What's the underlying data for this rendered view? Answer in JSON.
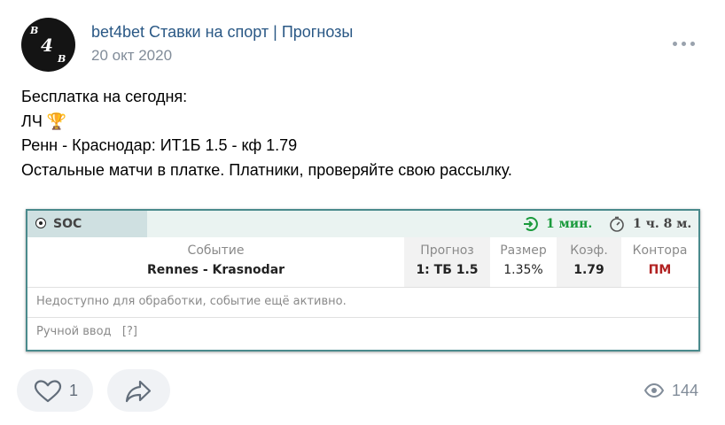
{
  "post": {
    "author": "bet4bet Ставки на спорт | Прогнозы",
    "date": "20 окт 2020",
    "lines": [
      "Бесплатка на сегодня:",
      "ЛЧ 🏆",
      "Ренн - Краснодар: ИТ1Б 1.5 - кф 1.79",
      "Остальные матчи в платке. Платники, проверяйте свою рассылку."
    ]
  },
  "avatar": {
    "letters": [
      "B",
      "4",
      "B"
    ]
  },
  "card": {
    "sport": "SOC",
    "timer": "1 мин.",
    "duration": "1 ч. 8 м.",
    "columns": {
      "event": {
        "header": "Событие",
        "value": "Rennes - Krasnodar"
      },
      "forecast": {
        "header": "Прогноз",
        "value": "1: ТБ 1.5"
      },
      "size": {
        "header": "Размер",
        "value": "1.35%"
      },
      "odds": {
        "header": "Коэф.",
        "value": "1.79"
      },
      "bookmaker": {
        "header": "Контора",
        "value": "ПМ"
      }
    },
    "notice": "Недоступно для обработки, событие ещё активно.",
    "manual_input": "Ручной ввод",
    "help": "[?]"
  },
  "footer": {
    "likes": "1",
    "views": "144"
  },
  "colors": {
    "link": "#2a5885",
    "accent_green": "#1a9a3c",
    "bookmaker_red": "#b22222",
    "card_border": "#4a8a8c"
  }
}
